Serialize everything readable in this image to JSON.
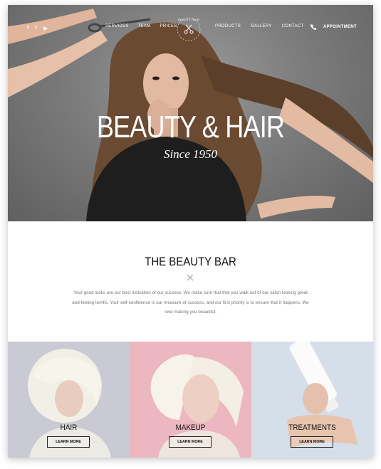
{
  "nav": {
    "social": [
      {
        "icon": "facebook-icon",
        "glyph": "f"
      },
      {
        "icon": "twitter-icon",
        "glyph": "t"
      },
      {
        "icon": "youtube-icon",
        "glyph": "▶"
      }
    ],
    "left_items": [
      "SERVICES",
      "TEAM",
      "PRICES"
    ],
    "right_items": [
      "PRODUCTS",
      "GALLERY",
      "CONTACT"
    ],
    "logo_text": "BEAUTY HAIR",
    "appointment_label": "APPOINTMENT",
    "phone_icon": "phone-icon"
  },
  "hero": {
    "title": "BEAUTY & HAIR",
    "subtitle": "Since 1950"
  },
  "intro": {
    "title": "THE BEAUTY BAR",
    "text": "Your good looks are our best indication of our success. We make sure that that you walk out of our salon looking great and feeling terrific. Your self-confidence is our measure of success, and our first priority is to ensure that it happens. We love making you beautiful."
  },
  "services": [
    {
      "title": "HAIR",
      "button": "LEARN MORE"
    },
    {
      "title": "MAKEUP",
      "button": "LEARN MORE"
    },
    {
      "title": "TREATMENTS",
      "button": "LEARN MORE"
    }
  ],
  "colors": {
    "accent": "#e8c23a",
    "hair_bg": "#c9cad3",
    "makeup_bg": "#ecb7c0",
    "treatments_bg": "#d5dfea"
  }
}
